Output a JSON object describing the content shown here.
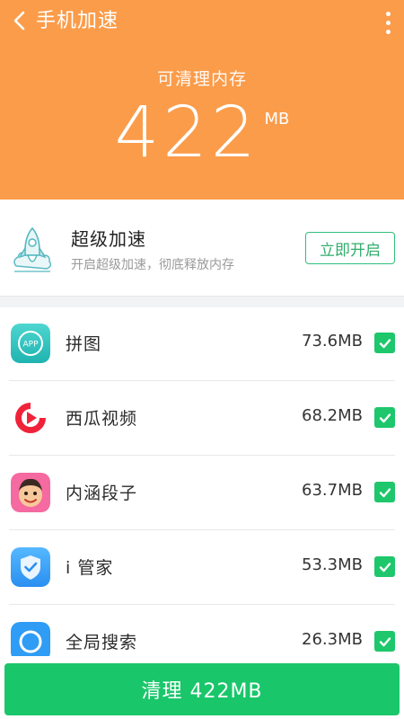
{
  "header": {
    "title": "手机加速",
    "memory_label": "可清理内存",
    "memory_value": "422",
    "memory_unit": "MB",
    "bg_color": "#fb9c4a"
  },
  "boost": {
    "title": "超级加速",
    "subtitle": "开启超级加速，彻底释放内存",
    "button_label": "立即开启",
    "icon": "rocket-icon"
  },
  "apps": [
    {
      "name": "拼图",
      "size": "73.6MB",
      "icon": "app-icon",
      "checked": true
    },
    {
      "name": "西瓜视频",
      "size": "68.2MB",
      "icon": "xigua-video-icon",
      "checked": true
    },
    {
      "name": "内涵段子",
      "size": "63.7MB",
      "icon": "neihan-duanzi-icon",
      "checked": true
    },
    {
      "name": "i 管家",
      "size": "53.3MB",
      "icon": "shield-icon",
      "checked": true
    },
    {
      "name": "全局搜索",
      "size": "26.3MB",
      "icon": "search-icon",
      "checked": true
    }
  ],
  "bottom": {
    "clean_button_label": "清理 422MB",
    "accent_color": "#1ac66a"
  }
}
